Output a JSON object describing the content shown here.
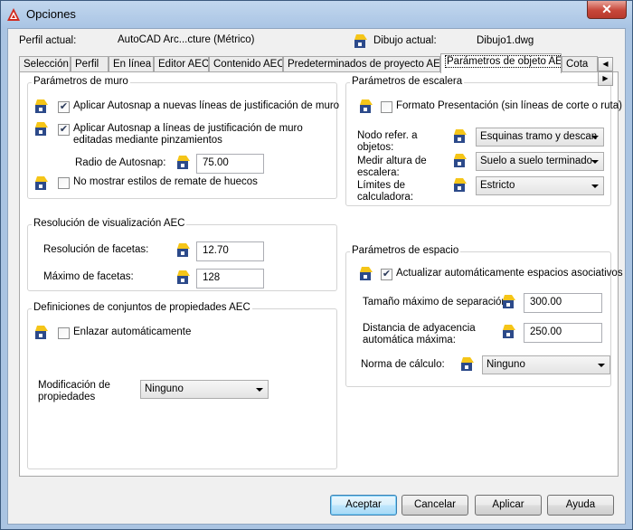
{
  "window": {
    "title": "Opciones",
    "close_label": "✕"
  },
  "profile": {
    "label": "Perfil actual:",
    "value": "AutoCAD Arc...cture (Métrico)",
    "drawing_label": "Dibujo actual:",
    "drawing_value": "Dibujo1.dwg"
  },
  "tabs": [
    {
      "label": "Selección"
    },
    {
      "label": "Perfil"
    },
    {
      "label": "En línea"
    },
    {
      "label": "Editor AEC"
    },
    {
      "label": "Contenido AEC"
    },
    {
      "label": "Predeterminados de proyecto AEC"
    },
    {
      "label": "Parámetros de objeto AEC"
    },
    {
      "label": "Cota"
    }
  ],
  "tab_scroll": {
    "left": "◀",
    "right": "▶"
  },
  "wall": {
    "title": "Parámetros de muro",
    "autosnap_new": "Aplicar Autosnap a nuevas líneas de justificación de muro",
    "autosnap_edit_1": "Aplicar Autosnap a líneas de justificación de muro",
    "autosnap_edit_2": "editadas mediante pinzamientos",
    "radius_label": "Radio de Autosnap:",
    "radius_value": "75.00",
    "no_styles": "No mostrar estilos de remate de huecos",
    "autosnap_new_checked": true,
    "autosnap_edit_checked": true,
    "no_styles_checked": false
  },
  "stairs": {
    "title": "Parámetros de escalera",
    "presentation": "Formato Presentación (sin líneas de corte o ruta)",
    "presentation_checked": false,
    "node_label_1": "Nodo refer. a",
    "node_label_2": "objetos:",
    "node_value": "Esquinas tramo y descan",
    "height_label_1": "Medir altura de",
    "height_label_2": "escalera:",
    "height_value": "Suelo a suelo terminado",
    "calc_label_1": "Límites de",
    "calc_label_2": "calculadora:",
    "calc_value": "Estricto"
  },
  "display": {
    "title": "Resolución de visualización AEC",
    "facet_res_label": "Resolución de facetas:",
    "facet_res_value": "12.70",
    "facet_max_label": "Máximo de facetas:",
    "facet_max_value": "128"
  },
  "propsets": {
    "title": "Definiciones de conjuntos de propiedades AEC",
    "auto_attach": "Enlazar automáticamente",
    "auto_attach_checked": false,
    "mod_label_1": "Modificación de",
    "mod_label_2": "propiedades",
    "mod_value": "Ninguno"
  },
  "space": {
    "title": "Parámetros de espacio",
    "auto_update": "Actualizar automáticamente espacios asociativos",
    "auto_update_checked": true,
    "max_sep_label": "Tamaño máximo de separación:",
    "max_sep_value": "300.00",
    "adj_label_1": "Distancia de adyacencia",
    "adj_label_2": "automática máxima:",
    "adj_value": "250.00",
    "norm_label": "Norma de cálculo:",
    "norm_value": "Ninguno"
  },
  "buttons": {
    "accept": "Aceptar",
    "cancel": "Cancelar",
    "apply": "Aplicar",
    "help": "Ayuda"
  }
}
